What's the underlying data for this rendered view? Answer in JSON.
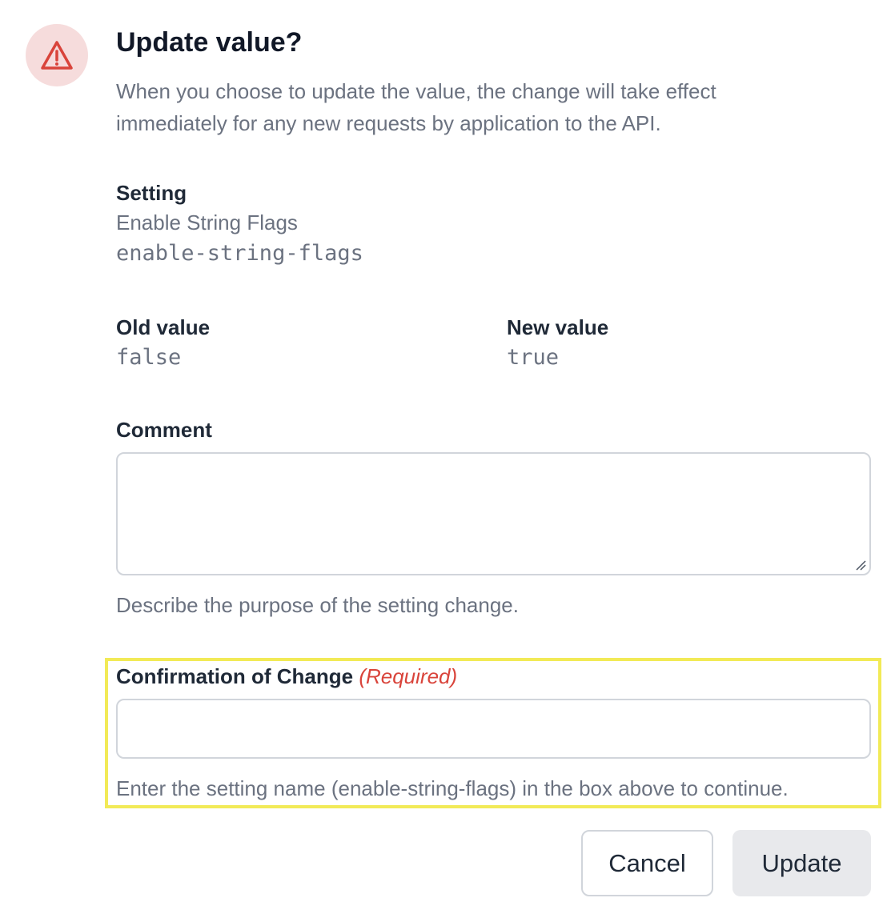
{
  "dialog": {
    "title": "Update value?",
    "description": "When you choose to update the value, the change will take effect immediately for any new requests by application to the API.",
    "icon": "warning-triangle-icon",
    "accent_color": "#d9443b"
  },
  "setting": {
    "label": "Setting",
    "display_name": "Enable String Flags",
    "key": "enable-string-flags"
  },
  "old_value": {
    "label": "Old value",
    "value": "false"
  },
  "new_value": {
    "label": "New value",
    "value": "true"
  },
  "comment": {
    "label": "Comment",
    "value": "",
    "hint": "Describe the purpose of the setting change."
  },
  "confirmation": {
    "label": "Confirmation of Change",
    "required_text": "(Required)",
    "value": "",
    "hint": "Enter the setting name (enable-string-flags) in the box above to continue.",
    "highlight_color": "#f2ea57"
  },
  "buttons": {
    "cancel": "Cancel",
    "update": "Update"
  }
}
